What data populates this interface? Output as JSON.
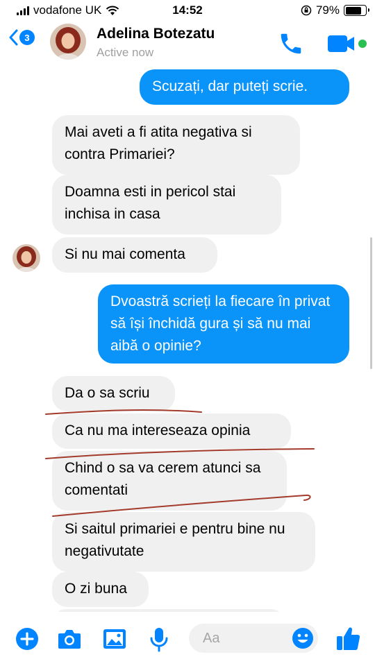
{
  "status_bar": {
    "carrier": "vodafone UK",
    "time": "14:52",
    "battery": "79%",
    "battery_level": 0.79,
    "icons": [
      "signal-icon",
      "wifi-icon",
      "orientation-lock-icon",
      "battery-icon"
    ]
  },
  "header": {
    "back_badge": "3",
    "contact_name": "Adelina Botezatu",
    "presence": "Active now",
    "icons": [
      "back-chevron-icon",
      "phone-icon",
      "video-camera-icon"
    ]
  },
  "messages": [
    {
      "direction": "outgoing",
      "text": "Scuzați, dar puteți scrie."
    },
    {
      "direction": "incoming",
      "text": "Mai aveti a fi atita negativa si contra Primariei?"
    },
    {
      "direction": "incoming",
      "text": "Doamna esti in pericol stai inchisa in casa"
    },
    {
      "direction": "incoming",
      "text": "Si nu mai comenta"
    },
    {
      "direction": "outgoing",
      "text": "Dvoastră scrieți la fiecare în privat să își închidă gura și să nu mai aibă o opinie?"
    },
    {
      "direction": "incoming",
      "text": "Da o sa scriu"
    },
    {
      "direction": "incoming",
      "text": "Ca nu ma intereseaza opinia"
    },
    {
      "direction": "incoming",
      "text": "Chind o sa va cerem atunci sa comentati"
    },
    {
      "direction": "incoming",
      "text": "Si saitul primariei e pentru bine nu negativutate"
    },
    {
      "direction": "incoming",
      "text": "O zi buna"
    }
  ],
  "composer": {
    "placeholder": "Aa",
    "icons": [
      "plus-icon",
      "camera-icon",
      "image-icon",
      "microphone-icon",
      "emoji-icon",
      "thumbs-up-icon"
    ]
  },
  "colors": {
    "accent": "#0084ff",
    "outgoing_bubble": "#0a93f8",
    "incoming_bubble": "#f0f0f0",
    "annotation_line": "#a33a2a",
    "presence_text": "#a0a0a0"
  }
}
